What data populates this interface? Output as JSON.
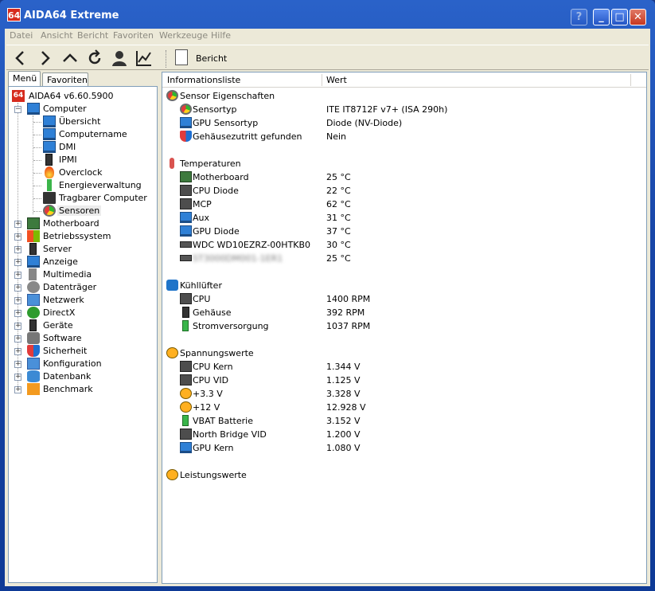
{
  "window": {
    "title": "AIDA64 Extreme",
    "app_icon_text": "64",
    "controls": {
      "help": "?",
      "minimize": "_",
      "maximize": "□",
      "close": "✕"
    }
  },
  "menubar": {
    "items": [
      "Datei",
      "Ansicht",
      "Bericht",
      "Favoriten",
      "Werkzeuge",
      "Hilfe"
    ]
  },
  "toolbar": {
    "icons": [
      "back-icon",
      "forward-icon",
      "up-icon",
      "refresh-icon",
      "user-icon",
      "chart-icon"
    ],
    "report_label": "Bericht"
  },
  "left_panel": {
    "tabs": [
      "Menü",
      "Favoriten"
    ],
    "active_tab": "Menü",
    "root": {
      "label": "AIDA64 v6.60.5900",
      "icon": "app-icon"
    },
    "computer": {
      "label": "Computer",
      "children": [
        "Übersicht",
        "Computername",
        "DMI",
        "IPMI",
        "Overclock",
        "Energieverwaltung",
        "Tragbarer Computer",
        "Sensoren"
      ],
      "selected": "Sensoren"
    },
    "categories": [
      "Motherboard",
      "Betriebssystem",
      "Server",
      "Anzeige",
      "Multimedia",
      "Datenträger",
      "Netzwerk",
      "DirectX",
      "Geräte",
      "Software",
      "Sicherheit",
      "Konfiguration",
      "Datenbank",
      "Benchmark"
    ]
  },
  "right_panel": {
    "columns": [
      "Informationsliste",
      "Wert"
    ],
    "sections": [
      {
        "title": "Sensor Eigenschaften",
        "icon": "gauge-icon",
        "rows": [
          {
            "name": "Sensortyp",
            "value": "ITE IT8712F v7+  (ISA 290h)",
            "icon": "gauge-icon"
          },
          {
            "name": "GPU Sensortyp",
            "value": "Diode  (NV-Diode)",
            "icon": "monitor-icon"
          },
          {
            "name": "Gehäusezutritt gefunden",
            "value": "Nein",
            "icon": "shield-icon"
          }
        ]
      },
      {
        "title": "Temperaturen",
        "icon": "thermometer-icon",
        "rows": [
          {
            "name": "Motherboard",
            "value": "25 °C",
            "icon": "motherboard-icon"
          },
          {
            "name": "CPU Diode",
            "value": "22 °C",
            "icon": "cpu-icon"
          },
          {
            "name": "MCP",
            "value": "62 °C",
            "icon": "chip-icon"
          },
          {
            "name": "Aux",
            "value": "31 °C",
            "icon": "monitor-icon"
          },
          {
            "name": "GPU Diode",
            "value": "37 °C",
            "icon": "monitor-icon"
          },
          {
            "name": "WDC WD10EZRZ-00HTKB0",
            "value": "30 °C",
            "icon": "hdd-icon"
          },
          {
            "name": "ST3000DM001-1ER1",
            "value": "25 °C",
            "icon": "hdd-icon",
            "blurred": true
          }
        ]
      },
      {
        "title": "Kühllüfter",
        "icon": "fan-icon",
        "rows": [
          {
            "name": "CPU",
            "value": "1400 RPM",
            "icon": "cpu-icon"
          },
          {
            "name": "Gehäuse",
            "value": "392 RPM",
            "icon": "case-icon"
          },
          {
            "name": "Stromversorgung",
            "value": "1037 RPM",
            "icon": "battery-icon"
          }
        ]
      },
      {
        "title": "Spannungswerte",
        "icon": "bolt-icon",
        "rows": [
          {
            "name": "CPU Kern",
            "value": "1.344 V",
            "icon": "cpu-icon"
          },
          {
            "name": "CPU VID",
            "value": "1.125 V",
            "icon": "cpu-icon"
          },
          {
            "name": "+3.3 V",
            "value": "3.328 V",
            "icon": "bolt-icon"
          },
          {
            "name": "+12 V",
            "value": "12.928 V",
            "icon": "bolt-icon"
          },
          {
            "name": "VBAT Batterie",
            "value": "3.152 V",
            "icon": "battery-icon"
          },
          {
            "name": "North Bridge VID",
            "value": "1.200 V",
            "icon": "chip-icon"
          },
          {
            "name": "GPU Kern",
            "value": "1.080 V",
            "icon": "monitor-icon"
          }
        ]
      },
      {
        "title": "Leistungswerte",
        "icon": "bolt-icon",
        "rows": []
      }
    ]
  }
}
